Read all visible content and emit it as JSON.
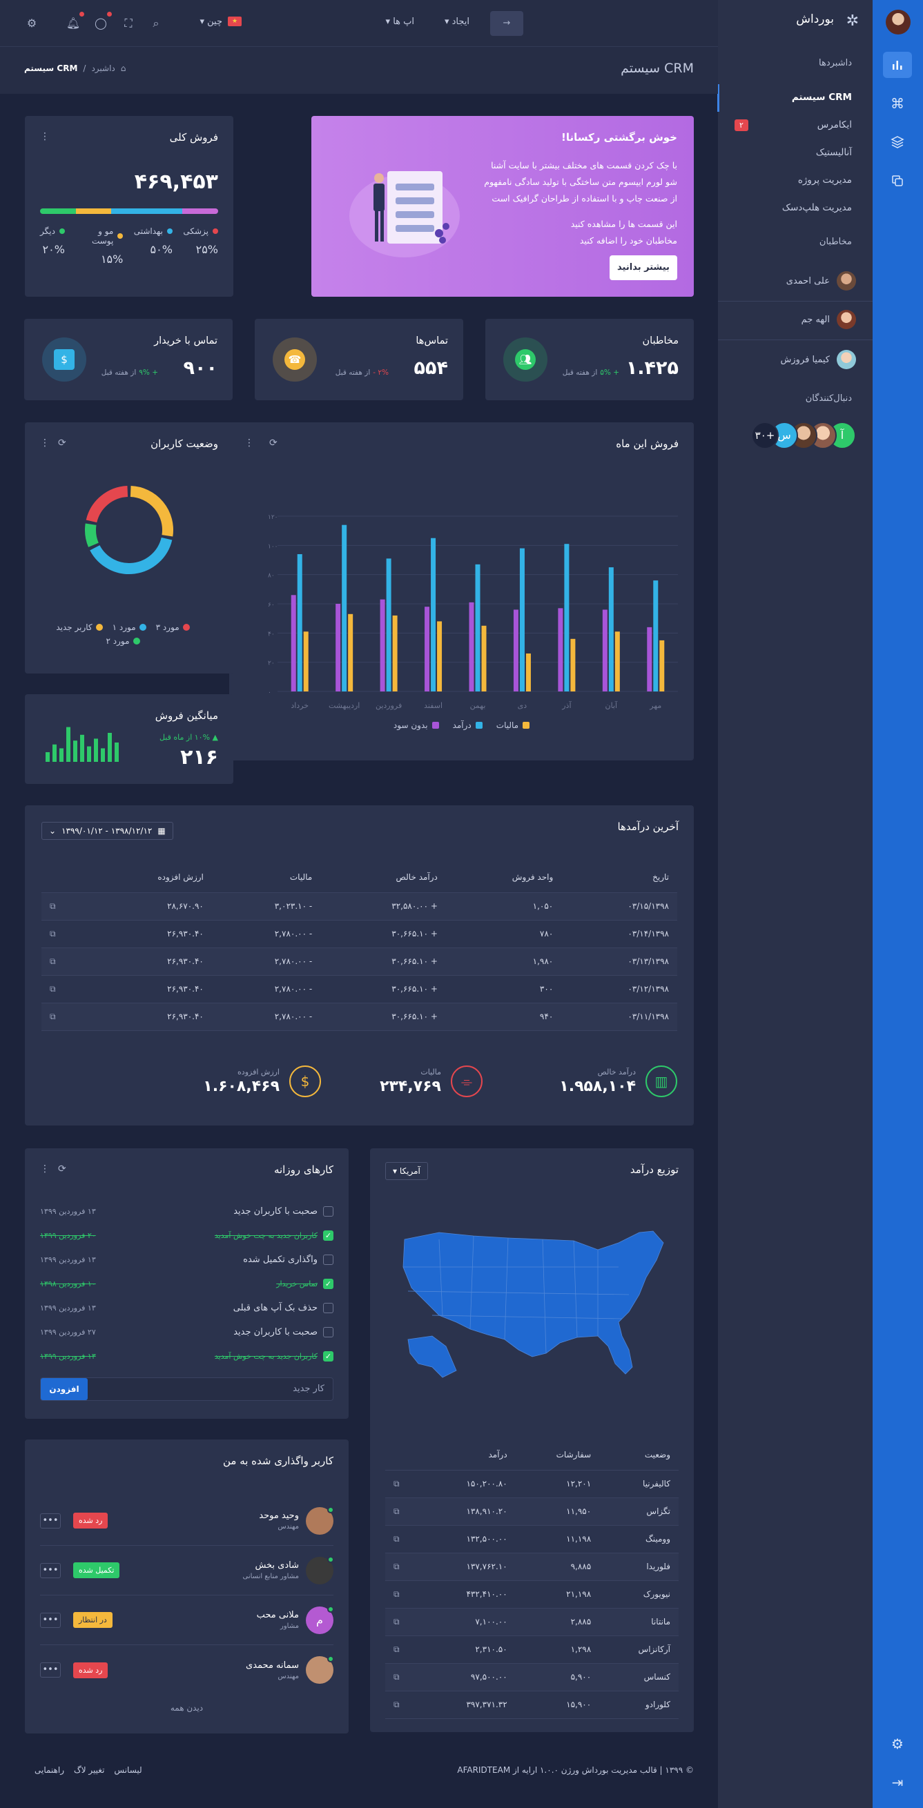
{
  "brand": {
    "name": "بورداش"
  },
  "sidebar": {
    "section_dashboards": "داشبردها",
    "items": [
      {
        "label": "CRM سیستم"
      },
      {
        "label": "ایکامرس",
        "badge": "۲"
      },
      {
        "label": "آنالیستیک"
      },
      {
        "label": "مدیریت پروژه"
      },
      {
        "label": "مدیریت هلپ‌دسک"
      }
    ],
    "section_contacts": "مخاطبان",
    "contacts": [
      {
        "name": "علی احمدی"
      },
      {
        "name": "الهه جم"
      },
      {
        "name": "کیمیا فروزش"
      }
    ],
    "section_followers": "دنبال‌کنندگان",
    "followers_more": "+۳۰",
    "follower_initials": [
      "آ",
      "س"
    ]
  },
  "topbar": {
    "create_label": "ایجاد",
    "apps_label": "اپ ها",
    "language_label": "چین"
  },
  "page": {
    "title": "CRM سیستم",
    "breadcrumb_home": "داشبرد",
    "breadcrumb_current": "CRM سیستم"
  },
  "welcome": {
    "title": "خوش برگشتی رکسانا!",
    "text": "با چک کردن قسمت های مختلف بیشتر با سایت آشنا شو لورم ایپسوم متن ساختگی با تولید سادگی نامفهوم از صنعت چاپ و با استفاده از طراحان گرافیک است",
    "text2": "این قسمت ها را مشاهده کنید مخاطبان خود را اضافه کنید",
    "button": "بیشتر بدانید"
  },
  "total_sales": {
    "title": "فروش کلی",
    "value": "۴۶۹,۴۵۳",
    "segments": [
      {
        "label": "پزشکی",
        "pct": "۲۵%",
        "color": "#e5474e",
        "bar": "#c86ad8",
        "frac": 0.2
      },
      {
        "label": "بهداشتی",
        "pct": "۵۰%",
        "color": "#33b3e6",
        "bar": "#33b3e6",
        "frac": 0.4
      },
      {
        "label": "مو و پوست",
        "pct": "۱۵%",
        "color": "#f4b83c",
        "bar": "#f4b83c",
        "frac": 0.2
      },
      {
        "label": "دیگر",
        "pct": "۲۰%",
        "color": "#2ec96a",
        "bar": "#2ec96a",
        "frac": 0.2
      }
    ]
  },
  "stats": [
    {
      "title": "مخاطبان",
      "value": "۱.۴۲۵",
      "change": "+ ۵%",
      "period": "از هفته قبل",
      "up": true,
      "color": "#2ec96a",
      "icon": "users-icon"
    },
    {
      "title": "تماس‌ها",
      "value": "۵۵۴",
      "change": "۲% -",
      "period": "از هفته قبل",
      "up": false,
      "color": "#f4b83c",
      "icon": "phone-icon"
    },
    {
      "title": "تماس با خریدار",
      "value": "۹۰۰",
      "change": "+ ۹%",
      "period": "از هفته قبل",
      "up": true,
      "color": "#33b3e6",
      "icon": "cash-icon"
    }
  ],
  "chart_data": {
    "type": "bar",
    "title": "فروش این ماه",
    "categories": [
      "خرداد",
      "اردیبهشت",
      "فروردین",
      "اسفند",
      "بهمن",
      "دی",
      "آذر",
      "آبان",
      "مهر"
    ],
    "series": [
      {
        "name": "بدون سود",
        "color": "#a855d8",
        "values": [
          66,
          60,
          63,
          58,
          61,
          56,
          57,
          56,
          44
        ]
      },
      {
        "name": "درآمد",
        "color": "#33b3e6",
        "values": [
          94,
          114,
          91,
          105,
          87,
          98,
          101,
          85,
          76
        ]
      },
      {
        "name": "مالیات",
        "color": "#f4b83c",
        "values": [
          41,
          53,
          52,
          48,
          45,
          26,
          36,
          41,
          35
        ]
      }
    ],
    "ylim": [
      0,
      120
    ],
    "yticks": [
      "۰",
      "۲۰",
      "۴۰",
      "۶۰",
      "۸۰",
      "۱۰۰",
      "۱۲۰"
    ],
    "legend": [
      "مالیات",
      "درآمد",
      "بدون سود"
    ]
  },
  "user_status": {
    "title": "وضعیت کاربران",
    "slices": [
      {
        "label": "کاربر جدید",
        "value": 28,
        "color": "#f4b83c"
      },
      {
        "label": "مورد ۱",
        "value": 40,
        "color": "#33b3e6"
      },
      {
        "label": "مورد ۲",
        "value": 10,
        "color": "#2ec96a"
      },
      {
        "label": "مورد ۳",
        "value": 22,
        "color": "#e5474e"
      }
    ]
  },
  "avg_sales": {
    "title": "میانگین فروش",
    "value": "۲۱۶",
    "change": "۱۰% از ماه قبل",
    "bars": [
      0.25,
      0.45,
      0.35,
      0.9,
      0.55,
      0.7,
      0.4,
      0.6,
      0.35,
      0.75,
      0.5
    ]
  },
  "revenue": {
    "title": "آخرین درآمدها",
    "date_range": "۱۳۹۸/۱۲/۱۲ - ۱۳۹۹/۰۱/۱۲",
    "headers": [
      "تاریخ",
      "واحد فروش",
      "درآمد خالص",
      "مالیات",
      "ارزش افزوده"
    ],
    "rows": [
      {
        "date": "۰۳/۱۵/۱۳۹۸",
        "units": "۱,۰۵۰",
        "net": "+ ۳۲,۵۸۰.۰۰",
        "tax": "- ۳,۰۲۳.۱۰",
        "vat": "۲۸,۶۷۰.۹۰"
      },
      {
        "date": "۰۳/۱۴/۱۳۹۸",
        "units": "۷۸۰",
        "net": "+ ۳۰,۶۶۵.۱۰",
        "tax": "- ۲,۷۸۰.۰۰",
        "vat": "۲۶,۹۳۰.۴۰"
      },
      {
        "date": "۰۳/۱۳/۱۳۹۸",
        "units": "۱,۹۸۰",
        "net": "+ ۳۰,۶۶۵.۱۰",
        "tax": "- ۲,۷۸۰.۰۰",
        "vat": "۲۶,۹۳۰.۴۰"
      },
      {
        "date": "۰۳/۱۲/۱۳۹۸",
        "units": "۳۰۰",
        "net": "+ ۳۰,۶۶۵.۱۰",
        "tax": "- ۲,۷۸۰.۰۰",
        "vat": "۲۶,۹۳۰.۴۰"
      },
      {
        "date": "۰۳/۱۱/۱۳۹۸",
        "units": "۹۴۰",
        "net": "+ ۳۰,۶۶۵.۱۰",
        "tax": "- ۲,۷۸۰.۰۰",
        "vat": "۲۶,۹۳۰.۴۰"
      }
    ],
    "summary": [
      {
        "label": "درآمد خالص",
        "value": "۱.۹۵۸,۱۰۴",
        "color": "#2ec96a",
        "icon": "chart-icon"
      },
      {
        "label": "مالیات",
        "value": "۲۳۴,۷۶۹",
        "color": "#e5474e",
        "icon": "tag-icon"
      },
      {
        "label": "ارزش افزوده",
        "value": "۱.۶۰۸,۴۶۹",
        "color": "#f4b83c",
        "icon": "dollar-icon"
      }
    ]
  },
  "distribution": {
    "title": "توزیع درآمد",
    "country": "آمریکا",
    "headers": [
      "وضعیت",
      "سفارشات",
      "درآمد"
    ],
    "rows": [
      {
        "state": "کالیفرنیا",
        "orders": "۱۲,۲۰۱",
        "revenue": "۱۵۰,۲۰۰.۸۰",
        "up": true
      },
      {
        "state": "تگزاس",
        "orders": "۱۱,۹۵۰",
        "revenue": "۱۳۸,۹۱۰.۲۰",
        "up": true
      },
      {
        "state": "وومینگ",
        "orders": "۱۱,۱۹۸",
        "revenue": "۱۳۲,۵۰۰.۰۰",
        "up": false
      },
      {
        "state": "فلوریدا",
        "orders": "۹,۸۸۵",
        "revenue": "۱۳۷,۷۶۲.۱۰",
        "up": true
      },
      {
        "state": "نیویورک",
        "orders": "۲۱,۱۹۸",
        "revenue": "۴۳۲,۴۱۰.۰۰",
        "up": false
      },
      {
        "state": "مانتانا",
        "orders": "۲,۸۸۵",
        "revenue": "۷,۱۰۰.۰۰",
        "up": true
      },
      {
        "state": "آرکانزاس",
        "orders": "۱,۲۹۸",
        "revenue": "۲,۳۱۰.۵۰",
        "up": true
      },
      {
        "state": "کنساس",
        "orders": "۵,۹۰۰",
        "revenue": "۹۷,۵۰۰.۰۰",
        "up": false
      },
      {
        "state": "کلورادو",
        "orders": "۱۵,۹۰۰",
        "revenue": "۳۹۷,۳۷۱.۳۲",
        "up": false
      }
    ]
  },
  "tasks": {
    "title": "کارهای روزانه",
    "items": [
      {
        "text": "صحبت با کاربران جدید",
        "date": "۱۳ فروردین ۱۳۹۹",
        "done": false
      },
      {
        "text": "کاربران جدید به چت خوش آمدید",
        "date": "۲۰ فروردین ۱۳۹۹",
        "done": true
      },
      {
        "text": "واگذاری تکمیل شده",
        "date": "۱۳ فروردین ۱۳۹۹",
        "done": false
      },
      {
        "text": "تماس خریدار",
        "date": "۱۰ فروردین ۱۳۹۸",
        "done": true
      },
      {
        "text": "حذف بک آپ های قبلی",
        "date": "۱۳ فروردین ۱۳۹۹",
        "done": false
      },
      {
        "text": "صحبت با کاربران جدید",
        "date": "۲۷ فروردین ۱۳۹۹",
        "done": false
      },
      {
        "text": "کاربران جدید به چت خوش آمدید",
        "date": "۱۳ فروردین ۱۳۹۹",
        "done": true
      }
    ],
    "input_placeholder": "کار جدید",
    "add_label": "افزودن"
  },
  "assigned": {
    "title": "کاربر واگذاری شده به من",
    "users": [
      {
        "name": "وحید موحد",
        "role": "مهندس",
        "status": "رد شده",
        "color": "#e5474e",
        "avatar": "#b07a5a"
      },
      {
        "name": "شادی بخش",
        "role": "مشاور منابع انسانی",
        "status": "تکمیل شده",
        "color": "#2ec96a",
        "avatar": "#3a3a3a"
      },
      {
        "name": "ملانی محب",
        "role": "مشاور",
        "status": "در انتظار",
        "color": "#f4b83c",
        "avatar": "#b45ad2",
        "initial": "م"
      },
      {
        "name": "سمانه محمدی",
        "role": "مهندس",
        "status": "رد شده",
        "color": "#e5474e",
        "avatar": "#c09070"
      }
    ],
    "view_all": "دیدن همه"
  },
  "footer": {
    "copyright": "© ۱۳۹۹ | قالب مدیریت بورداش ورژن ۱.۰.۰ ارایه از AFARIDTEAM",
    "links": [
      "لیسانس",
      "تغییر لاگ",
      "راهنمایی"
    ]
  }
}
